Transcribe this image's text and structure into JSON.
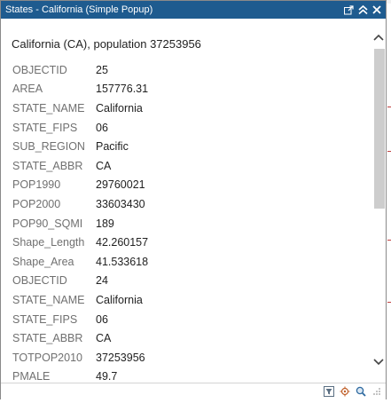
{
  "popup": {
    "title": "States - California (Simple Popup)",
    "heading": "California (CA), population 37253956",
    "title_buttons": [
      "popout-icon",
      "collapse-icon",
      "close-icon"
    ],
    "footer_icons": [
      "filter-icon",
      "pan-to-icon",
      "zoom-to-icon",
      "resize-grip-icon"
    ],
    "colors": {
      "titlebar": "#1e5b8f",
      "field_name": "#707070",
      "field_value": "#222222"
    }
  },
  "fields": [
    {
      "name": "OBJECTID",
      "value": "25"
    },
    {
      "name": "AREA",
      "value": "157776.31"
    },
    {
      "name": "STATE_NAME",
      "value": "California"
    },
    {
      "name": "STATE_FIPS",
      "value": "06"
    },
    {
      "name": "SUB_REGION",
      "value": "Pacific"
    },
    {
      "name": "STATE_ABBR",
      "value": "CA"
    },
    {
      "name": "POP1990",
      "value": "29760021"
    },
    {
      "name": "POP2000",
      "value": "33603430"
    },
    {
      "name": "POP90_SQMI",
      "value": "189"
    },
    {
      "name": "Shape_Length",
      "value": "42.260157"
    },
    {
      "name": "Shape_Area",
      "value": "41.533618"
    },
    {
      "name": "OBJECTID",
      "value": "24"
    },
    {
      "name": "STATE_NAME",
      "value": "California"
    },
    {
      "name": "STATE_FIPS",
      "value": "06"
    },
    {
      "name": "STATE_ABBR",
      "value": "CA"
    },
    {
      "name": "TOTPOP2010",
      "value": "37253956"
    },
    {
      "name": "PMALE",
      "value": "49.7"
    }
  ]
}
